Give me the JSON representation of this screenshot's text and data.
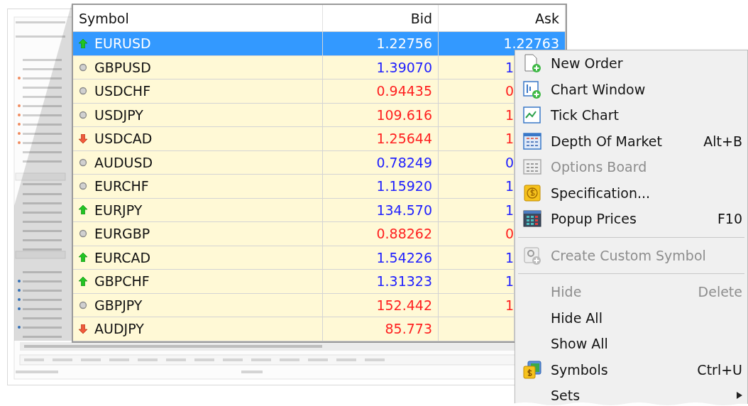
{
  "market_table": {
    "columns": [
      "Symbol",
      "Bid",
      "Ask"
    ],
    "rows": [
      {
        "symbol": "EURUSD",
        "kind": "up",
        "bid": "1.22756",
        "ask": "1.22763",
        "selected": true
      },
      {
        "symbol": "GBPUSD",
        "kind": "flat",
        "bid": "1.39070",
        "ask": "1",
        "color": "#2020ff",
        "selected": false
      },
      {
        "symbol": "USDCHF",
        "kind": "flat",
        "bid": "0.94435",
        "ask": "0",
        "color": "#ff2020",
        "selected": false
      },
      {
        "symbol": "USDJPY",
        "kind": "flat",
        "bid": "109.616",
        "ask": "1",
        "color": "#ff2020",
        "selected": false
      },
      {
        "symbol": "USDCAD",
        "kind": "down",
        "bid": "1.25644",
        "ask": "1",
        "color": "#ff2020",
        "selected": false
      },
      {
        "symbol": "AUDUSD",
        "kind": "flat",
        "bid": "0.78249",
        "ask": "0",
        "color": "#2020ff",
        "selected": false
      },
      {
        "symbol": "EURCHF",
        "kind": "flat",
        "bid": "1.15920",
        "ask": "1",
        "color": "#2020ff",
        "selected": false
      },
      {
        "symbol": "EURJPY",
        "kind": "up",
        "bid": "134.570",
        "ask": "1",
        "color": "#2020ff",
        "selected": false
      },
      {
        "symbol": "EURGBP",
        "kind": "flat",
        "bid": "0.88262",
        "ask": "0",
        "color": "#ff2020",
        "selected": false
      },
      {
        "symbol": "EURCAD",
        "kind": "up",
        "bid": "1.54226",
        "ask": "1",
        "color": "#2020ff",
        "selected": false
      },
      {
        "symbol": "GBPCHF",
        "kind": "up",
        "bid": "1.31323",
        "ask": "1",
        "color": "#2020ff",
        "selected": false
      },
      {
        "symbol": "GBPJPY",
        "kind": "flat",
        "bid": "152.442",
        "ask": "1",
        "color": "#ff2020",
        "selected": false
      },
      {
        "symbol": "AUDJPY",
        "kind": "down",
        "bid": "85.773",
        "color": "#ff2020",
        "selected": false
      }
    ]
  },
  "context_menu": [
    {
      "kind": "item",
      "label": "New Order",
      "disabled": false
    },
    {
      "kind": "item",
      "label": "Chart Window",
      "disabled": false
    },
    {
      "kind": "item",
      "label": "Tick Chart",
      "disabled": false
    },
    {
      "kind": "item",
      "label": "Depth Of Market",
      "shortcut": "Alt+B",
      "disabled": false
    },
    {
      "kind": "item",
      "label": "Options Board",
      "disabled": true
    },
    {
      "kind": "item",
      "label": "Specification...",
      "disabled": false
    },
    {
      "kind": "item",
      "label": "Popup Prices",
      "shortcut": "F10",
      "disabled": false
    },
    {
      "kind": "separator"
    },
    {
      "kind": "item",
      "label": "Create Custom Symbol",
      "disabled": true
    },
    {
      "kind": "separator"
    },
    {
      "kind": "item",
      "label": "Hide",
      "shortcut": "Delete",
      "disabled": true
    },
    {
      "kind": "item",
      "label": "Hide All",
      "disabled": false
    },
    {
      "kind": "item",
      "label": "Show All",
      "disabled": false
    },
    {
      "kind": "item",
      "label": "Symbols",
      "shortcut": "Ctrl+U",
      "disabled": false
    },
    {
      "kind": "item",
      "label": "Sets",
      "submenu": true,
      "disabled": false
    }
  ]
}
